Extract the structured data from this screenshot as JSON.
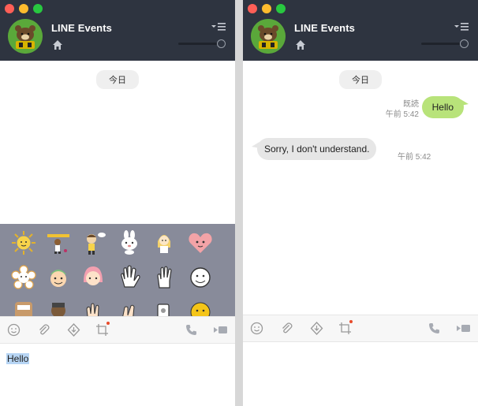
{
  "windows": {
    "left": {
      "title": "LINE Events",
      "date_label": "今日",
      "input_text": "Hello"
    },
    "right": {
      "title": "LINE Events",
      "date_label": "今日",
      "messages": [
        {
          "direction": "out",
          "text": "Hello",
          "status": "既読",
          "time": "午前 5:42"
        },
        {
          "direction": "in",
          "text": "Sorry, I don't understand.",
          "time": "午前 5:42"
        }
      ]
    }
  },
  "icons": {
    "emoji": "emoji-icon",
    "attach": "paperclip-icon",
    "download": "download-icon",
    "crop": "screenshot-crop-icon",
    "call": "phone-icon",
    "video": "video-call-icon",
    "home": "home-icon",
    "menu": "menu-icon"
  },
  "colors": {
    "titlebar": "#2e3440",
    "sent_bubble": "#b8e37a",
    "received_bubble": "#e6e6e6",
    "sticker_panel": "#888b9a",
    "notify_dot": "#e84b2b"
  }
}
